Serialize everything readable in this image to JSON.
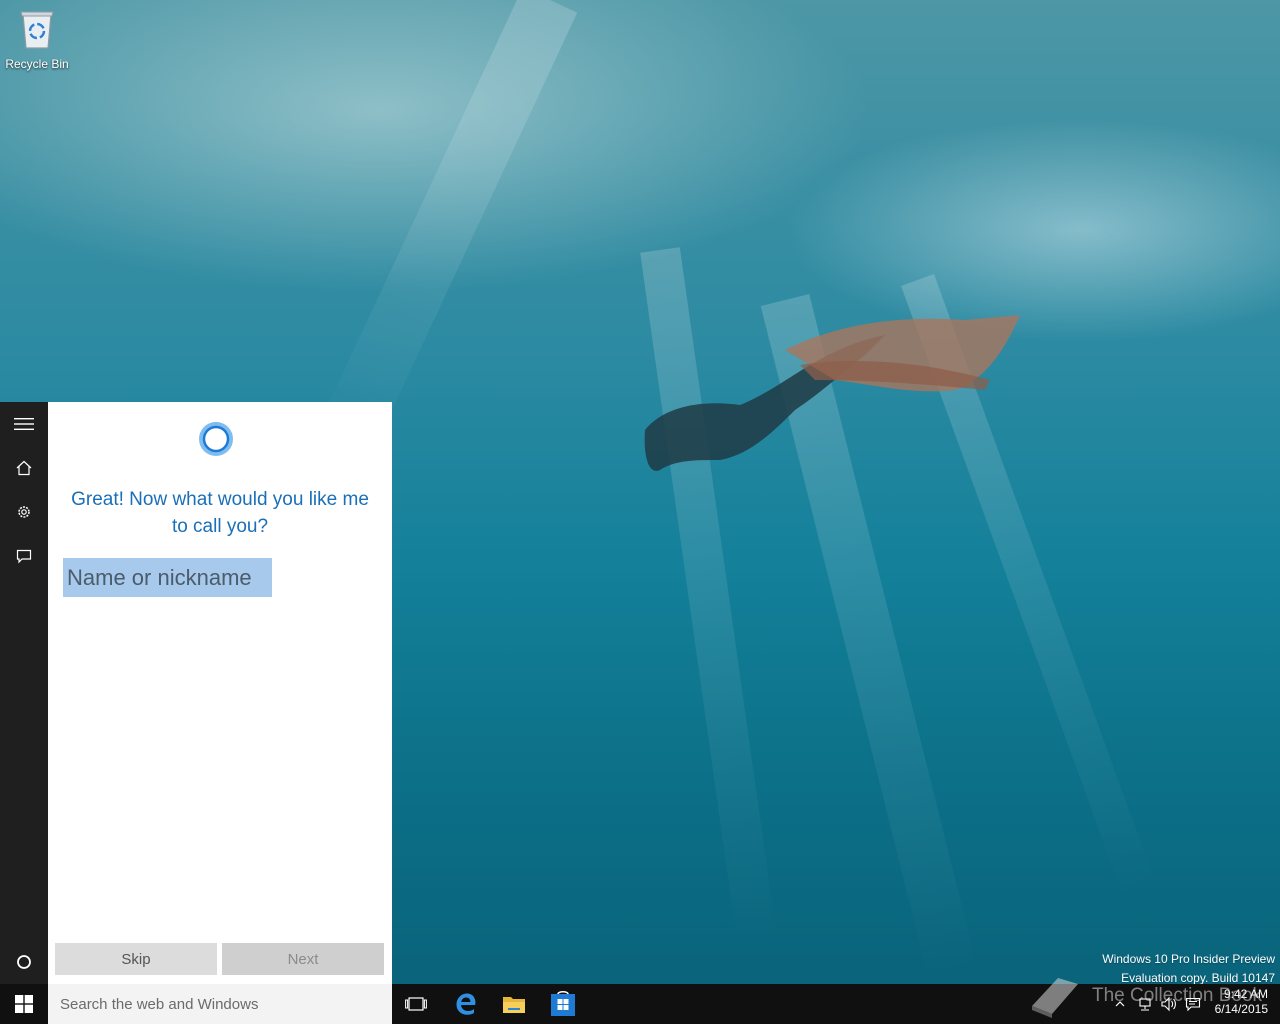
{
  "desktop": {
    "icons": [
      {
        "label": "Recycle Bin",
        "icon": "recycle-bin-icon"
      }
    ]
  },
  "cortana": {
    "prompt": "Great! Now what would you like me to call you?",
    "name_input": {
      "value": "",
      "placeholder": "Name or nickname"
    },
    "skip_label": "Skip",
    "next_label": "Next",
    "rail_icons": [
      "hamburger-icon",
      "home-icon",
      "gear-icon",
      "feedback-icon",
      "cortana-icon"
    ],
    "accent": "#1a6fb8"
  },
  "taskbar": {
    "search_placeholder": "Search the web and Windows",
    "pinned": [
      "task-view-icon",
      "edge-icon",
      "file-explorer-icon",
      "store-icon"
    ],
    "clock": {
      "time": "9:42 AM",
      "date": "6/14/2015"
    }
  },
  "watermark": {
    "line1": "Windows 10 Pro Insider Preview",
    "line2": "Evaluation copy. Build 10147"
  },
  "overlay_logo": {
    "text": "The Collection Book"
  }
}
